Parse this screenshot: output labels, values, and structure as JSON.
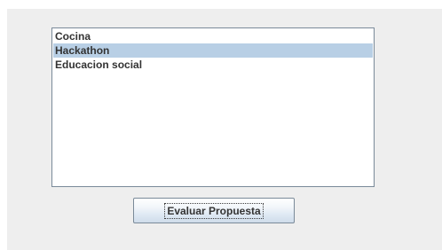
{
  "list": {
    "items": [
      {
        "label": "Cocina",
        "selected": false
      },
      {
        "label": "Hackathon",
        "selected": true
      },
      {
        "label": "Educacion social",
        "selected": false
      }
    ]
  },
  "actions": {
    "evaluate_label": "Evaluar Propuesta"
  },
  "colors": {
    "panel_bg": "#eeeeee",
    "selection_bg": "#b8cfe5",
    "border": "#7a8a99"
  }
}
